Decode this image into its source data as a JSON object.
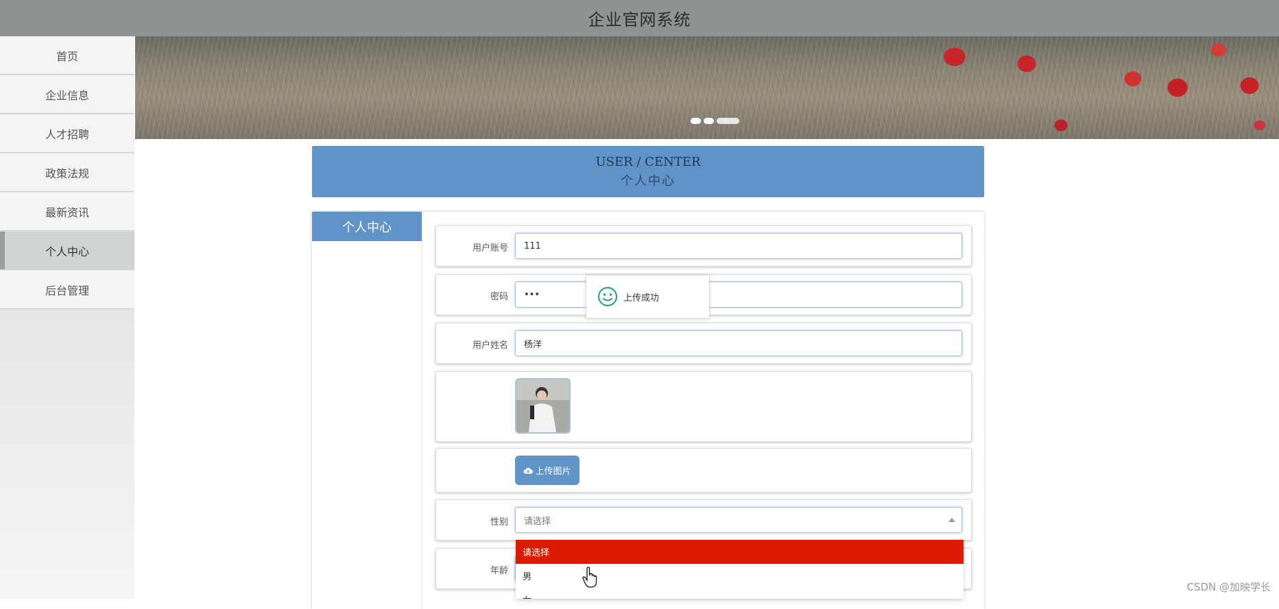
{
  "app": {
    "title": "企业官网系统"
  },
  "sidebar": {
    "items": [
      {
        "label": "首页"
      },
      {
        "label": "企业信息"
      },
      {
        "label": "人才招聘"
      },
      {
        "label": "政策法规"
      },
      {
        "label": "最新资讯"
      },
      {
        "label": "个人中心",
        "active": true
      },
      {
        "label": "后台管理"
      }
    ]
  },
  "banner": {
    "slides": 3,
    "active_slide": 3
  },
  "section_title": {
    "en": "USER / CENTER",
    "cn": "个人中心"
  },
  "panel": {
    "tab_label": "个人中心",
    "fields": {
      "account": {
        "label": "用户账号",
        "value": "111"
      },
      "password": {
        "label": "密码",
        "value": "•••"
      },
      "name": {
        "label": "用户姓名",
        "value": "杨洋"
      },
      "upload_button": "上传图片",
      "gender": {
        "label": "性别",
        "placeholder": "请选择",
        "options": [
          "请选择",
          "男",
          "女"
        ]
      },
      "age": {
        "label": "年龄"
      }
    }
  },
  "toast": {
    "message": "上传成功",
    "icon": "smile-icon"
  },
  "watermark": "CSDN @加映学长",
  "colors": {
    "accent": "#6094c9",
    "selected_option": "#dc1c00",
    "topbar": "#8e9393"
  }
}
